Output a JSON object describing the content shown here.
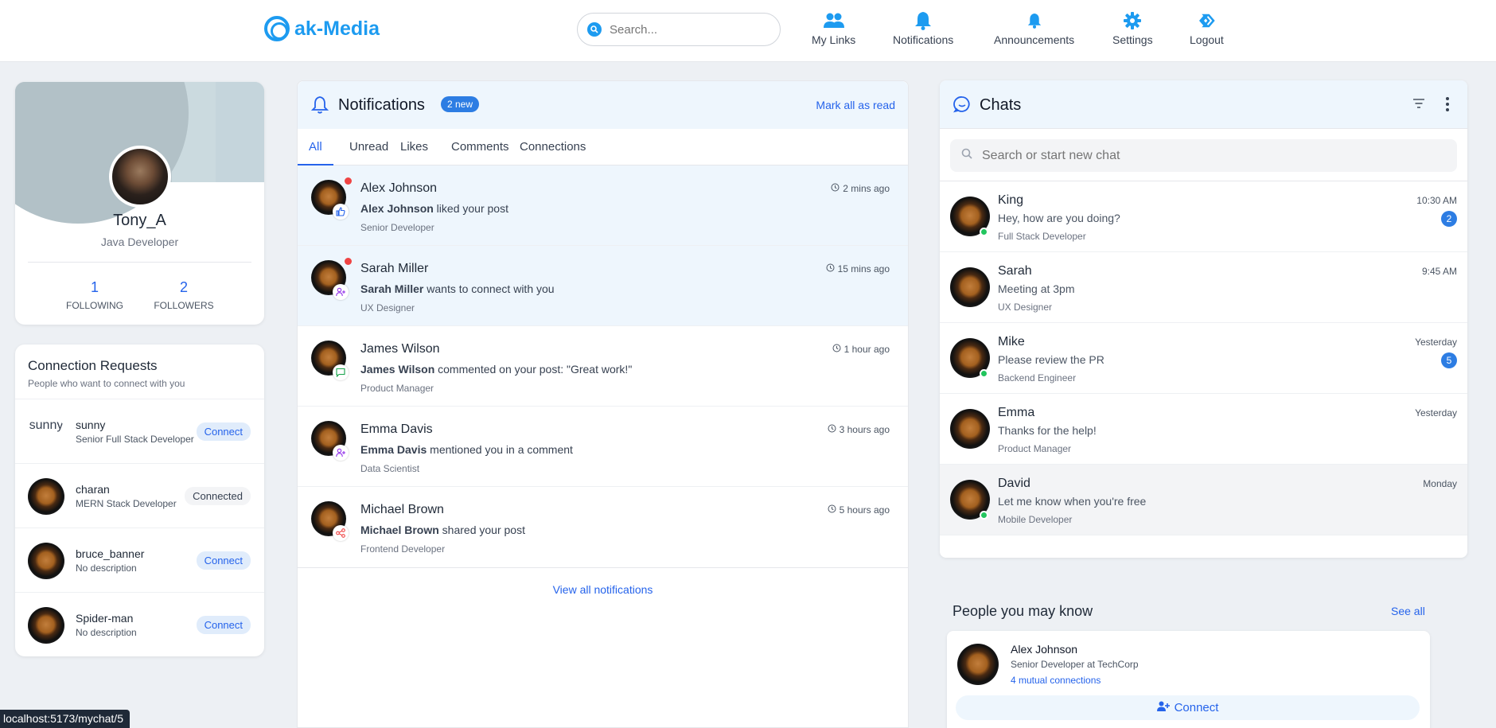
{
  "brand": {
    "name": "ak-Media",
    "color": "#1d9bf0"
  },
  "search": {
    "placeholder": "Search..."
  },
  "nav": [
    {
      "label": "My Links",
      "icon": "users-icon"
    },
    {
      "label": "Notifications",
      "icon": "bell-icon"
    },
    {
      "label": "Announcements",
      "icon": "bell-icon"
    },
    {
      "label": "Settings",
      "icon": "gear-icon"
    },
    {
      "label": "Logout",
      "icon": "logout-icon"
    }
  ],
  "profile": {
    "name": "Tony_A",
    "role": "Java Developer",
    "following_count": "1",
    "following_label": "FOLLOWING",
    "followers_count": "2",
    "followers_label": "FOLLOWERS"
  },
  "connection_requests": {
    "title": "Connection Requests",
    "subtitle": "People who want to connect with you",
    "items": [
      {
        "name": "sunny",
        "description": "Senior Full Stack Developer",
        "action": "Connect",
        "avatar_alt": "sunny"
      },
      {
        "name": "charan",
        "description": "MERN Stack Developer",
        "action": "Connected"
      },
      {
        "name": "bruce_banner",
        "description": "No description",
        "action": "Connect"
      },
      {
        "name": "Spider-man",
        "description": "No description",
        "action": "Connect"
      }
    ]
  },
  "notifications": {
    "title": "Notifications",
    "new_badge": "2 new",
    "mark_all": "Mark all as read",
    "tabs": [
      "All",
      "Unread",
      "Likes",
      "Comments",
      "Connections"
    ],
    "items": [
      {
        "name": "Alex Johnson",
        "actor": "Alex Johnson",
        "text": " liked your post",
        "role": "Senior Developer",
        "time": "2 mins ago",
        "unread": true,
        "type_icon": "thumbs-up-icon"
      },
      {
        "name": "Sarah Miller",
        "actor": "Sarah Miller",
        "text": " wants to connect with you",
        "role": "UX Designer",
        "time": "15 mins ago",
        "unread": true,
        "type_icon": "user-plus-icon"
      },
      {
        "name": "James Wilson",
        "actor": "James Wilson",
        "text": " commented on your post: \"Great work!\"",
        "role": "Product Manager",
        "time": "1 hour ago",
        "unread": false,
        "type_icon": "comment-icon"
      },
      {
        "name": "Emma Davis",
        "actor": "Emma Davis",
        "text": " mentioned you in a comment",
        "role": "Data Scientist",
        "time": "3 hours ago",
        "unread": false,
        "type_icon": "user-plus-icon"
      },
      {
        "name": "Michael Brown",
        "actor": "Michael Brown",
        "text": " shared your post",
        "role": "Frontend Developer",
        "time": "5 hours ago",
        "unread": false,
        "type_icon": "share-icon"
      }
    ],
    "view_all": "View all notifications"
  },
  "chats": {
    "title": "Chats",
    "search_placeholder": "Search or start new chat",
    "items": [
      {
        "name": "King",
        "message": "Hey, how are you doing?",
        "role": "Full Stack Developer",
        "time": "10:30 AM",
        "unread": "2",
        "online": true
      },
      {
        "name": "Sarah",
        "message": "Meeting at 3pm",
        "role": "UX Designer",
        "time": "9:45 AM",
        "unread": "",
        "online": false
      },
      {
        "name": "Mike",
        "message": "Please review the PR",
        "role": "Backend Engineer",
        "time": "Yesterday",
        "unread": "5",
        "online": true
      },
      {
        "name": "Emma",
        "message": "Thanks for the help!",
        "role": "Product Manager",
        "time": "Yesterday",
        "unread": "",
        "online": false
      },
      {
        "name": "David",
        "message": "Let me know when you're free",
        "role": "Mobile Developer",
        "time": "Monday",
        "unread": "",
        "online": true
      }
    ]
  },
  "people": {
    "title": "People you may know",
    "see_all": "See all",
    "items": [
      {
        "name": "Alex Johnson",
        "title": "Senior Developer at TechCorp",
        "mutual": "4 mutual connections",
        "action": "Connect"
      }
    ]
  },
  "status_bar": {
    "url": "localhost:5173/mychat/5"
  }
}
